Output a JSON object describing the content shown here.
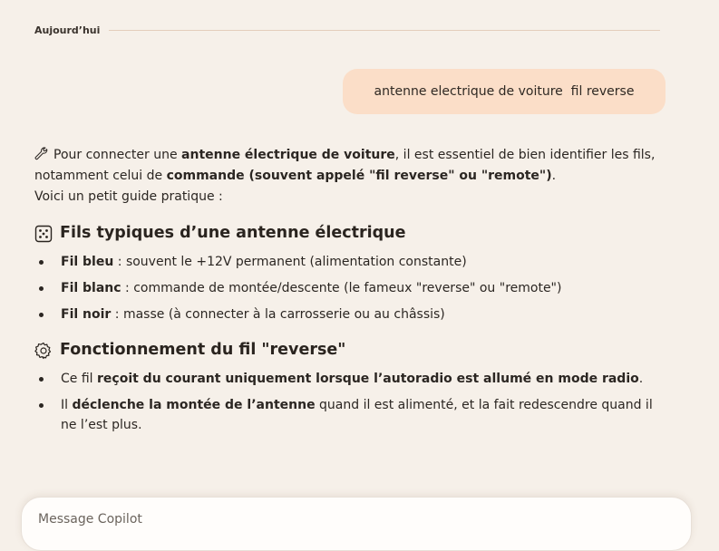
{
  "day_separator": {
    "label": "Aujourd’hui"
  },
  "user_message": {
    "text": "antenne electrique de voiture  fil reverse"
  },
  "answer": {
    "intro": {
      "t1": "Pour connecter une ",
      "b1": "antenne électrique de voiture",
      "t2": ", il est essentiel de bien identifier les fils, notamment celui de ",
      "b2": "commande (souvent appelé \"fil reverse\" ou \"remote\")",
      "t3": ".",
      "t4": "Voici un petit guide pratique :"
    },
    "section1": {
      "title": "Fils typiques d’une antenne électrique",
      "icon": "dice-icon",
      "items": [
        {
          "bold": "Fil bleu",
          "text": " : souvent le +12V permanent (alimentation constante)"
        },
        {
          "bold": "Fil blanc",
          "text": " : commande de montée/descente (le fameux \"reverse\" ou \"remote\")"
        },
        {
          "bold": "Fil noir",
          "text": " : masse (à connecter à la carrosserie ou au châssis)"
        }
      ]
    },
    "section2": {
      "title": "Fonctionnement du fil \"reverse\"",
      "icon": "gear-icon",
      "items": [
        {
          "pre": "Ce fil ",
          "bold": "reçoit du courant uniquement lorsque l’autoradio est allumé en mode radio",
          "post": "."
        },
        {
          "pre": "Il ",
          "bold": "déclenche la montée de l’antenne",
          "post": " quand il est alimenté, et la fait redescendre quand il ne l’est plus."
        }
      ]
    },
    "intro_icon": "wrench-icon"
  },
  "composer": {
    "placeholder": "Message Copilot"
  }
}
